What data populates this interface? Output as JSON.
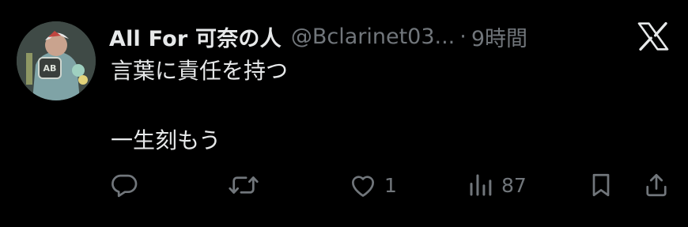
{
  "tweet": {
    "author_name": "All For 可奈の人",
    "handle": "@Bclarinet03...",
    "separator": "·",
    "time": "9時間",
    "lines": [
      "言葉に責任を持つ",
      "一生刻もう"
    ]
  },
  "actions": {
    "reply": {
      "icon": "reply-icon"
    },
    "retweet": {
      "icon": "retweet-icon"
    },
    "like": {
      "icon": "heart-icon",
      "count": "1"
    },
    "views": {
      "icon": "views-icon",
      "count": "87"
    },
    "bookmark": {
      "icon": "bookmark-icon"
    },
    "share": {
      "icon": "share-icon"
    }
  },
  "colors": {
    "background": "#000000",
    "text": "#e7e9ea",
    "muted": "#71767b"
  }
}
